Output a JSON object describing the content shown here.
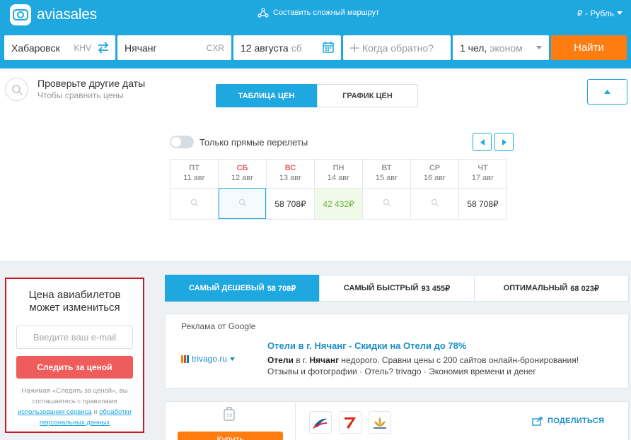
{
  "header": {
    "logo_text": "aviasales",
    "route_link": "Составить сложный маршрут",
    "currency": "₽ - Рубль"
  },
  "search": {
    "origin": "Хабаровск",
    "origin_code": "KHV",
    "destination": "Нячанг",
    "destination_code": "CXR",
    "depart_date": "12 августа",
    "depart_weekday": "сб",
    "return_placeholder": "Когда обратно?",
    "passengers": "1 чел,",
    "cabin_class": "эконом",
    "find_label": "Найти"
  },
  "flex_dates": {
    "title": "Проверьте другие даты",
    "subtitle": "Чтобы сравнить цены",
    "tab_table": "ТАБЛИЦА ЦЕН",
    "tab_graph": "ГРАФИК ЦЕН",
    "direct_only": "Только прямые перелеты",
    "days": [
      {
        "name": "ПТ",
        "date": "11 авг",
        "price": "",
        "weekend": false,
        "state": "empty"
      },
      {
        "name": "СБ",
        "date": "12 авг",
        "price": "",
        "weekend": true,
        "state": "selected"
      },
      {
        "name": "ВС",
        "date": "13 авг",
        "price": "58 708₽",
        "weekend": true,
        "state": "price"
      },
      {
        "name": "ПН",
        "date": "14 авг",
        "price": "42 432₽",
        "weekend": false,
        "state": "cheapest"
      },
      {
        "name": "ВТ",
        "date": "15 авг",
        "price": "",
        "weekend": false,
        "state": "empty"
      },
      {
        "name": "СР",
        "date": "16 авг",
        "price": "",
        "weekend": false,
        "state": "empty"
      },
      {
        "name": "ЧТ",
        "date": "17 авг",
        "price": "58 708₽",
        "weekend": false,
        "state": "price"
      }
    ]
  },
  "price_alert": {
    "title": "Цена авиабилетов может измениться",
    "email_placeholder": "Введите ваш e-mail",
    "track_label": "Следить за ценой",
    "terms_prefix": "Нажимая «Следить за ценой», вы соглашаетесь с правилами",
    "terms_link1": "использования сервиса",
    "terms_and": "и",
    "terms_link2": "обработки персональных данных"
  },
  "sort_tabs": [
    {
      "label": "САМЫЙ ДЕШЕВЫЙ",
      "price": "58 708₽",
      "active": true
    },
    {
      "label": "САМЫЙ БЫСТРЫЙ",
      "price": "93 455₽",
      "active": false
    },
    {
      "label": "ОПТИМАЛЬНЫЙ",
      "price": "68 023₽",
      "active": false
    }
  ],
  "ad": {
    "label": "Реклама от Google",
    "source": "trivago.ru",
    "title": "Отели в г. Нячанг - Скидки на Отели до 78%",
    "desc_bold1": "Отели",
    "desc_text1": " в г. ",
    "desc_bold2": "Нячанг",
    "desc_text2": " недорого. Сравни цены с 200 сайтов онлайн-бронирования!",
    "desc_line2": "Отзывы и фотографии · Отель? trivago · Экономия времени и денег"
  },
  "ticket": {
    "bag_number": "23",
    "buy_label": "Купить",
    "share_label": "ПОДЕЛИТЬСЯ"
  },
  "colors": {
    "brand": "#1fa7e0",
    "cta": "#ff7c10",
    "alert_button": "#ee5c5c",
    "alert_border": "#c9181f",
    "cheapest_text": "#6db33f"
  }
}
